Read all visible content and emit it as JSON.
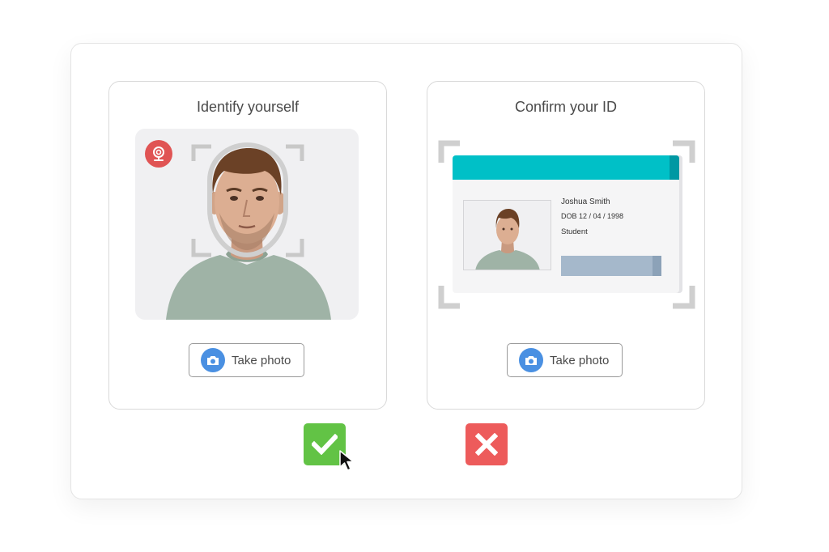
{
  "left_card": {
    "title": "Identify yourself",
    "button_label": "Take photo",
    "mic_badge_color": "#e05454"
  },
  "right_card": {
    "title": "Confirm your ID",
    "button_label": "Take photo",
    "id": {
      "name": "Joshua Smith",
      "dob": "DOB 12 / 04 / 1998",
      "role": "Student",
      "header_color": "#00c0c7"
    }
  },
  "actions": {
    "approve_color": "#62c345",
    "reject_color": "#ed5b5b"
  },
  "icons": {
    "mic": "microphone-icon",
    "camera": "camera-icon",
    "check": "check-icon",
    "close": "close-icon",
    "cursor": "mouse-pointer-icon"
  }
}
